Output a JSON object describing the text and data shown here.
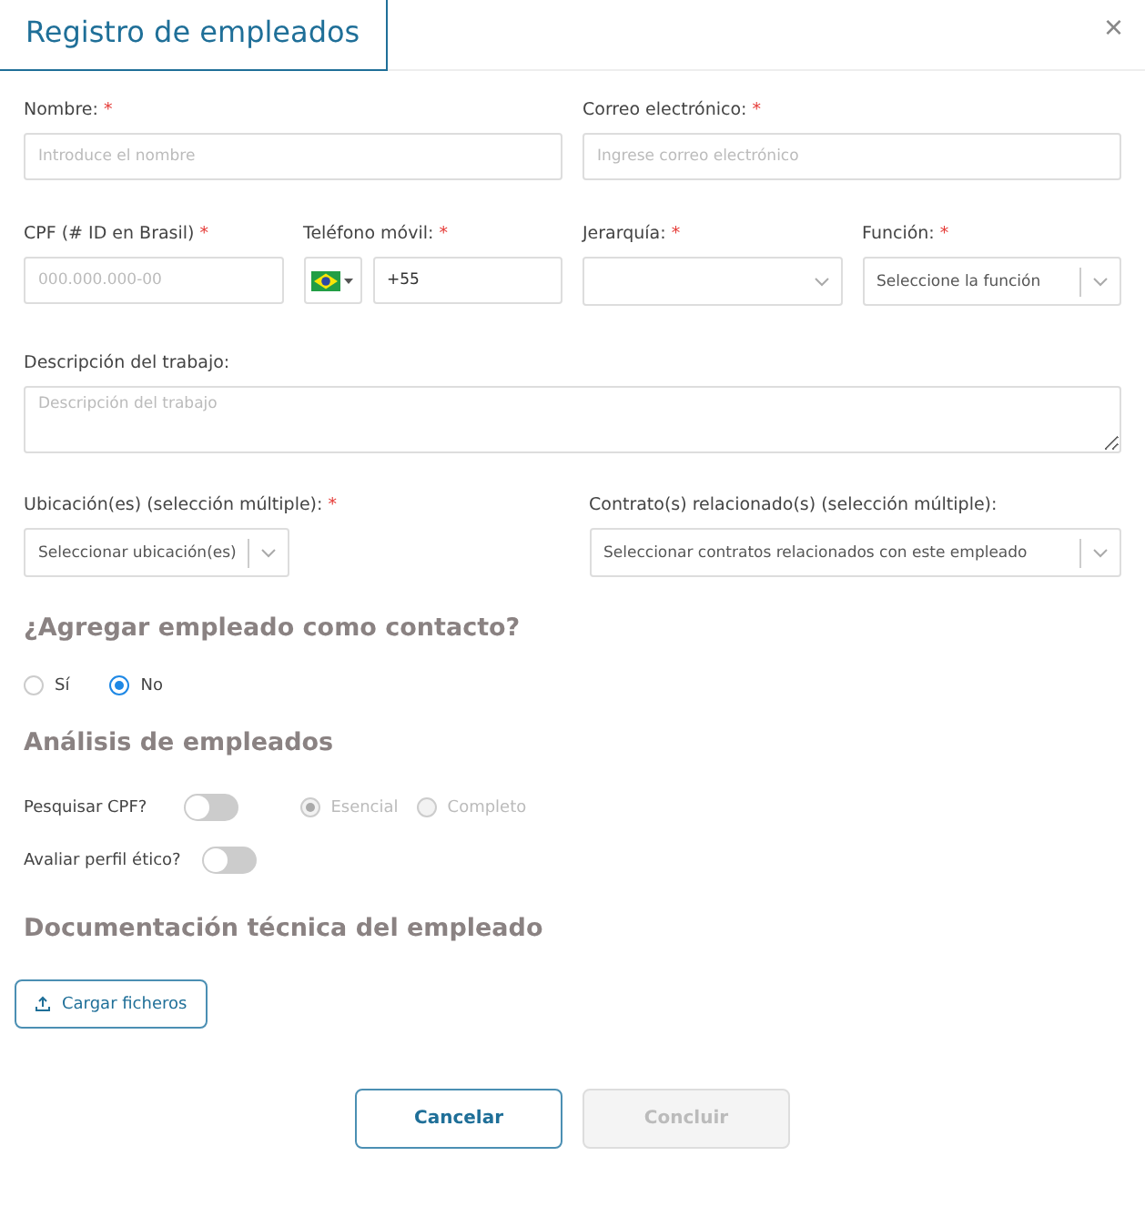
{
  "dialog": {
    "title": "Registro de empleados",
    "close": "×"
  },
  "required_mark": "*",
  "rows": [
    [
      {
        "kind": "text",
        "label": "Nombre:",
        "required": true,
        "placeholder": "Introduce el nombre"
      },
      {
        "kind": "text",
        "label": "Correo electrónico:",
        "required": true,
        "placeholder": "Ingrese correo electrónico"
      }
    ],
    [
      {
        "kind": "text",
        "label": "CPF (# ID en Brasil)",
        "required": true,
        "placeholder": "000.000.000-00"
      },
      {
        "kind": "phone",
        "label": "Teléfono móvil:",
        "required": true,
        "value": "+55"
      },
      {
        "kind": "select",
        "label": "Jerarquía:",
        "required": true
      },
      {
        "kind": "select",
        "label": "Función:",
        "required": true,
        "placeholder": "Seleccione la función"
      }
    ],
    [
      {
        "kind": "textarea",
        "label": "Descripción del trabajo:",
        "required": false,
        "placeholder": "Descripción del trabajo"
      }
    ],
    [
      {
        "kind": "select",
        "label": "Ubicación(es) (selección múltiple):",
        "required": true,
        "placeholder": "Seleccionar ubicación(es)"
      },
      {
        "kind": "select",
        "label": "Contrato(s) relacionado(s) (selección múltiple):",
        "required": false,
        "placeholder": "Seleccionar contratos relacionados con este empleado"
      }
    ]
  ],
  "contact": {
    "heading": "¿Agregar empleado como contacto?",
    "options": [
      {
        "label": "Sí",
        "selected": false
      },
      {
        "label": "No",
        "selected": true
      }
    ]
  },
  "analysis": {
    "heading": "Análisis de empleados",
    "rows": [
      {
        "label": "Pesquisar CPF?",
        "on": false,
        "options": [
          {
            "label": "Esencial",
            "selected": true,
            "disabled": true
          },
          {
            "label": "Completo",
            "selected": false,
            "disabled": true
          }
        ]
      },
      {
        "label": "Avaliar perfil ético?",
        "on": false
      }
    ]
  },
  "documents": {
    "heading": "Documentación técnica del empleado",
    "upload": "Cargar ficheros"
  },
  "buttons": [
    {
      "label": "Cancelar",
      "disabled": false
    },
    {
      "label": "Concluir",
      "disabled": true
    }
  ]
}
